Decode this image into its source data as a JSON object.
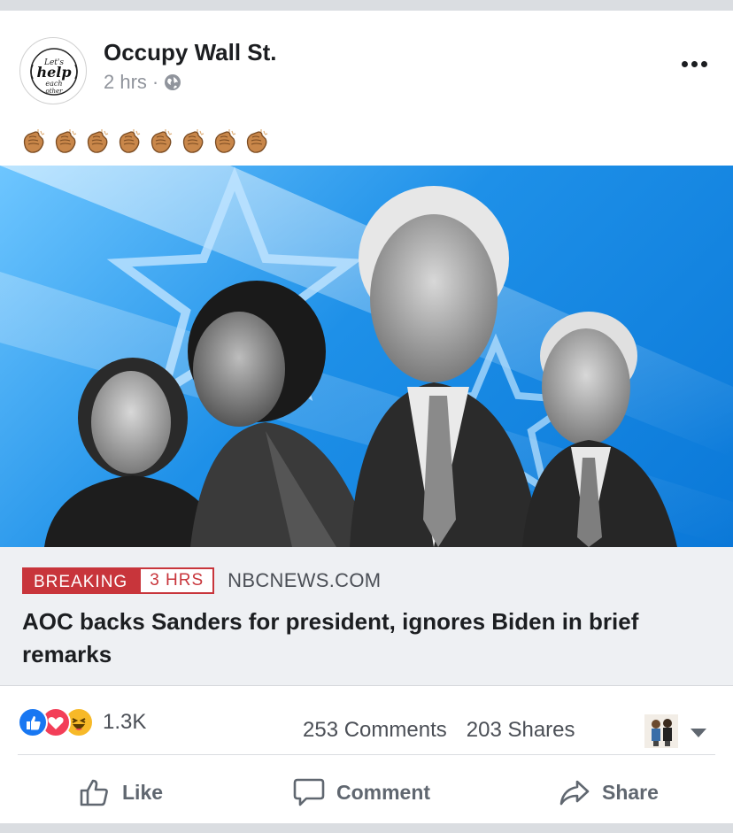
{
  "post": {
    "page_name": "Occupy Wall St.",
    "time_ago": "2 hrs",
    "separator": "·",
    "privacy_icon": "globe-icon",
    "emoji_text": "👏👏👏👏👏👏👏👏",
    "clap_count": 8
  },
  "link": {
    "badge_breaking": "BREAKING",
    "badge_time": "3 HRS",
    "source": "NBCNEWS.COM",
    "headline": "AOC backs Sanders for president, ignores Biden in brief remarks"
  },
  "engagement": {
    "reaction_count": "1.3K",
    "comments": "253 Comments",
    "shares": "203 Shares"
  },
  "actions": {
    "like": "Like",
    "comment": "Comment",
    "share": "Share"
  },
  "colors": {
    "like_blue": "#1877f2",
    "love_red": "#f33e58",
    "haha_yellow": "#f7b928",
    "breaking_red": "#c8353b"
  }
}
